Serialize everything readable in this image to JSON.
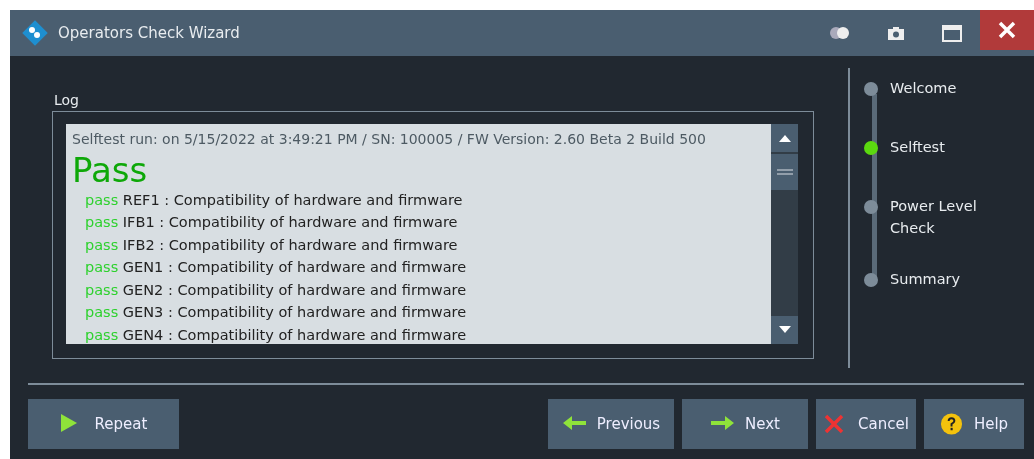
{
  "window": {
    "title": "Operators Check Wizard"
  },
  "log": {
    "label": "Log",
    "header": "Selftest run: on 5/15/2022 at 3:49:21 PM / SN: 100005 / FW Version: 2.60 Beta 2 Build 500",
    "result": "Pass",
    "entries": [
      {
        "status": "pass",
        "text": "REF1 : Compatibility of hardware and firmware"
      },
      {
        "status": "pass",
        "text": "IFB1 : Compatibility of hardware and firmware"
      },
      {
        "status": "pass",
        "text": "IFB2 : Compatibility of hardware and firmware"
      },
      {
        "status": "pass",
        "text": "GEN1 : Compatibility of hardware and firmware"
      },
      {
        "status": "pass",
        "text": "GEN2 : Compatibility of hardware and firmware"
      },
      {
        "status": "pass",
        "text": "GEN3 : Compatibility of hardware and firmware"
      },
      {
        "status": "pass",
        "text": "GEN4 : Compatibility of hardware and firmware"
      }
    ]
  },
  "steps": [
    {
      "label": "Welcome",
      "selected": false
    },
    {
      "label": "Selftest",
      "selected": true
    },
    {
      "label": "Power Level Check",
      "selected": false
    },
    {
      "label": "Summary",
      "selected": false
    }
  ],
  "buttons": [
    {
      "kind": "repeat",
      "label": "Repeat"
    },
    {
      "kind": "previous",
      "label": "Previous"
    },
    {
      "kind": "next",
      "label": "Next"
    },
    {
      "kind": "cancel",
      "label": "Cancel"
    },
    {
      "kind": "help",
      "label": "Help"
    }
  ]
}
